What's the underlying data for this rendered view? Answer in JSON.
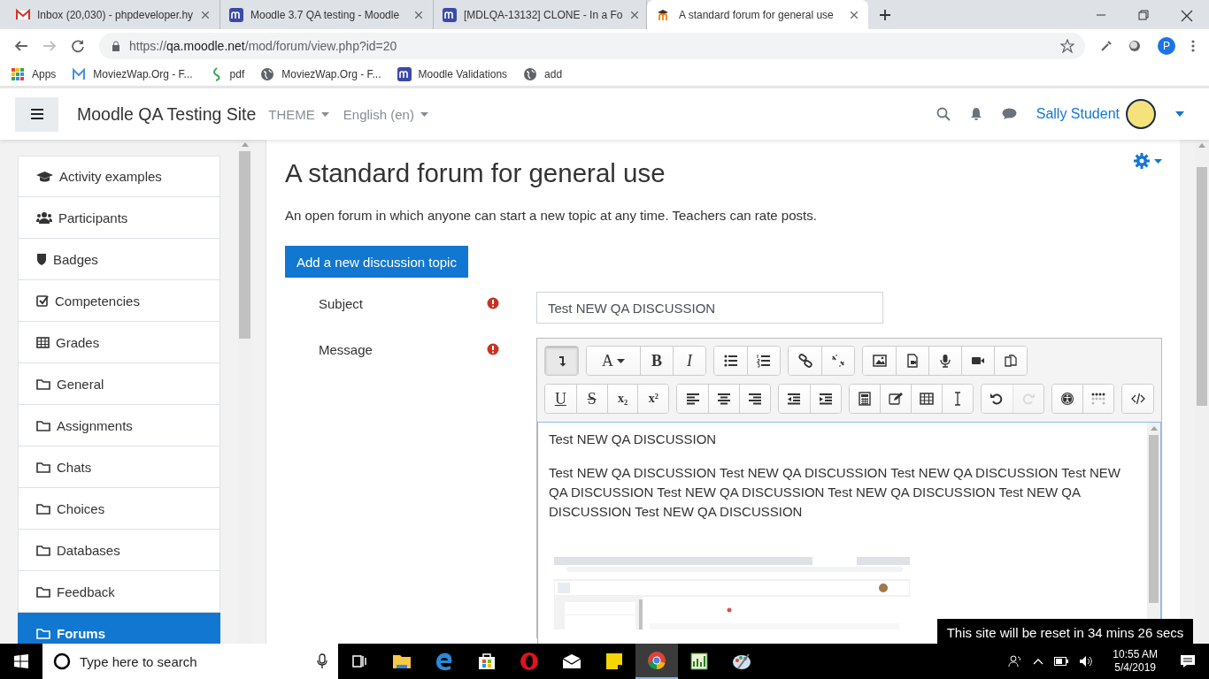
{
  "browser": {
    "tabs": [
      {
        "title": "Inbox (20,030) - phpdeveloper.hy",
        "kind": "gmail",
        "selected": false
      },
      {
        "title": "Moodle 3.7 QA testing - Moodle",
        "kind": "moodle",
        "selected": false
      },
      {
        "title": "[MDLQA-13132] CLONE - In a Fo",
        "kind": "moodle",
        "selected": false
      },
      {
        "title": "A standard forum for general use",
        "kind": "moodle-cap",
        "selected": true
      }
    ],
    "address": {
      "scheme": "https://",
      "host": "qa.moodle.net",
      "path": "/mod/forum/view.php?id=20"
    },
    "profile_initial": "P",
    "bookmarks": [
      {
        "label": "Apps",
        "kind": "apps"
      },
      {
        "label": "MoviezWap.Org - F...",
        "kind": "m-logo"
      },
      {
        "label": "pdf",
        "kind": "leaf"
      },
      {
        "label": "MoviezWap.Org - F...",
        "kind": "globe"
      },
      {
        "label": "Moodle Validations",
        "kind": "moodle"
      },
      {
        "label": "add",
        "kind": "globe"
      }
    ]
  },
  "navbar": {
    "site_name": "Moodle QA Testing Site",
    "menus": [
      "THEME",
      "English (en)"
    ],
    "user": "Sally Student"
  },
  "drawer": {
    "items": [
      {
        "label": "Activity examples",
        "kind": "cap",
        "selected": false
      },
      {
        "label": "Participants",
        "kind": "users",
        "selected": false
      },
      {
        "label": "Badges",
        "kind": "shield",
        "selected": false
      },
      {
        "label": "Competencies",
        "kind": "check",
        "selected": false
      },
      {
        "label": "Grades",
        "kind": "table",
        "selected": false
      },
      {
        "label": "General",
        "kind": "folder",
        "selected": false
      },
      {
        "label": "Assignments",
        "kind": "folder",
        "selected": false
      },
      {
        "label": "Chats",
        "kind": "folder",
        "selected": false
      },
      {
        "label": "Choices",
        "kind": "folder",
        "selected": false
      },
      {
        "label": "Databases",
        "kind": "folder",
        "selected": false
      },
      {
        "label": "Feedback",
        "kind": "folder",
        "selected": false
      },
      {
        "label": "Forums",
        "kind": "folder",
        "selected": true
      }
    ]
  },
  "page": {
    "title": "A standard forum for general use",
    "intro": "An open forum in which anyone can start a new topic at any time. Teachers can rate posts.",
    "add_button": "Add a new discussion topic",
    "form": {
      "subject_label": "Subject",
      "subject_value": "Test NEW QA DISCUSSION",
      "message_label": "Message",
      "toolbar": [
        [
          [
            {
              "kind": "icon",
              "pressed": true,
              "disabled": false
            }
          ],
          [
            {
              "kind": "font",
              "label": "A",
              "pressed": false,
              "disabled": false
            },
            {
              "kind": "bold",
              "label": "B",
              "pressed": false,
              "disabled": false
            },
            {
              "kind": "italic",
              "label": "I",
              "pressed": false,
              "disabled": false
            }
          ],
          [
            {
              "kind": "icon",
              "pressed": false,
              "disabled": false
            },
            {
              "kind": "icon",
              "pressed": false,
              "disabled": false
            }
          ],
          [
            {
              "kind": "icon",
              "pressed": false,
              "disabled": false
            },
            {
              "kind": "icon",
              "pressed": false,
              "disabled": false
            }
          ],
          [
            {
              "kind": "icon",
              "pressed": false,
              "disabled": false
            },
            {
              "kind": "icon",
              "pressed": false,
              "disabled": false
            },
            {
              "kind": "icon",
              "pressed": false,
              "disabled": false
            },
            {
              "kind": "icon",
              "pressed": false,
              "disabled": false
            },
            {
              "kind": "icon",
              "pressed": false,
              "disabled": false
            }
          ]
        ],
        [
          [
            {
              "kind": "underline",
              "label": "U",
              "pressed": false,
              "disabled": false
            },
            {
              "kind": "strike",
              "label": "S",
              "pressed": false,
              "disabled": false
            },
            {
              "kind": "sub",
              "label": "x₂",
              "pressed": false,
              "disabled": false
            },
            {
              "kind": "sup",
              "label": "x²",
              "pressed": false,
              "disabled": false
            }
          ],
          [
            {
              "kind": "icon",
              "pressed": false,
              "disabled": false
            },
            {
              "kind": "icon",
              "pressed": false,
              "disabled": false
            },
            {
              "kind": "icon",
              "pressed": false,
              "disabled": false
            }
          ],
          [
            {
              "kind": "icon",
              "pressed": false,
              "disabled": false
            },
            {
              "kind": "icon",
              "pressed": false,
              "disabled": false
            }
          ],
          [
            {
              "kind": "icon",
              "pressed": false,
              "disabled": false
            },
            {
              "kind": "icon",
              "pressed": false,
              "disabled": false
            },
            {
              "kind": "icon",
              "pressed": false,
              "disabled": false
            },
            {
              "kind": "icon",
              "pressed": false,
              "disabled": false
            }
          ],
          [
            {
              "kind": "icon",
              "pressed": false,
              "disabled": false
            },
            {
              "kind": "icon",
              "pressed": false,
              "disabled": true
            }
          ],
          [
            {
              "kind": "icon",
              "pressed": false,
              "disabled": false
            },
            {
              "kind": "icon",
              "pressed": false,
              "disabled": false
            }
          ],
          [
            {
              "kind": "icon",
              "pressed": false,
              "disabled": false
            }
          ]
        ]
      ],
      "message_paragraphs": [
        "Test NEW QA DISCUSSION",
        "Test NEW QA DISCUSSION Test NEW QA DISCUSSION Test NEW QA DISCUSSION Test NEW QA DISCUSSION Test NEW QA DISCUSSION Test NEW QA DISCUSSION Test NEW QA DISCUSSION Test NEW QA DISCUSSION"
      ],
      "embedded": {
        "kind": "picture"
      }
    }
  },
  "notice": "This site will be reset in 34 mins 26 secs",
  "taskbar": {
    "search_placeholder": "Type here to search",
    "time": "10:55 AM",
    "date": "5/4/2019"
  }
}
